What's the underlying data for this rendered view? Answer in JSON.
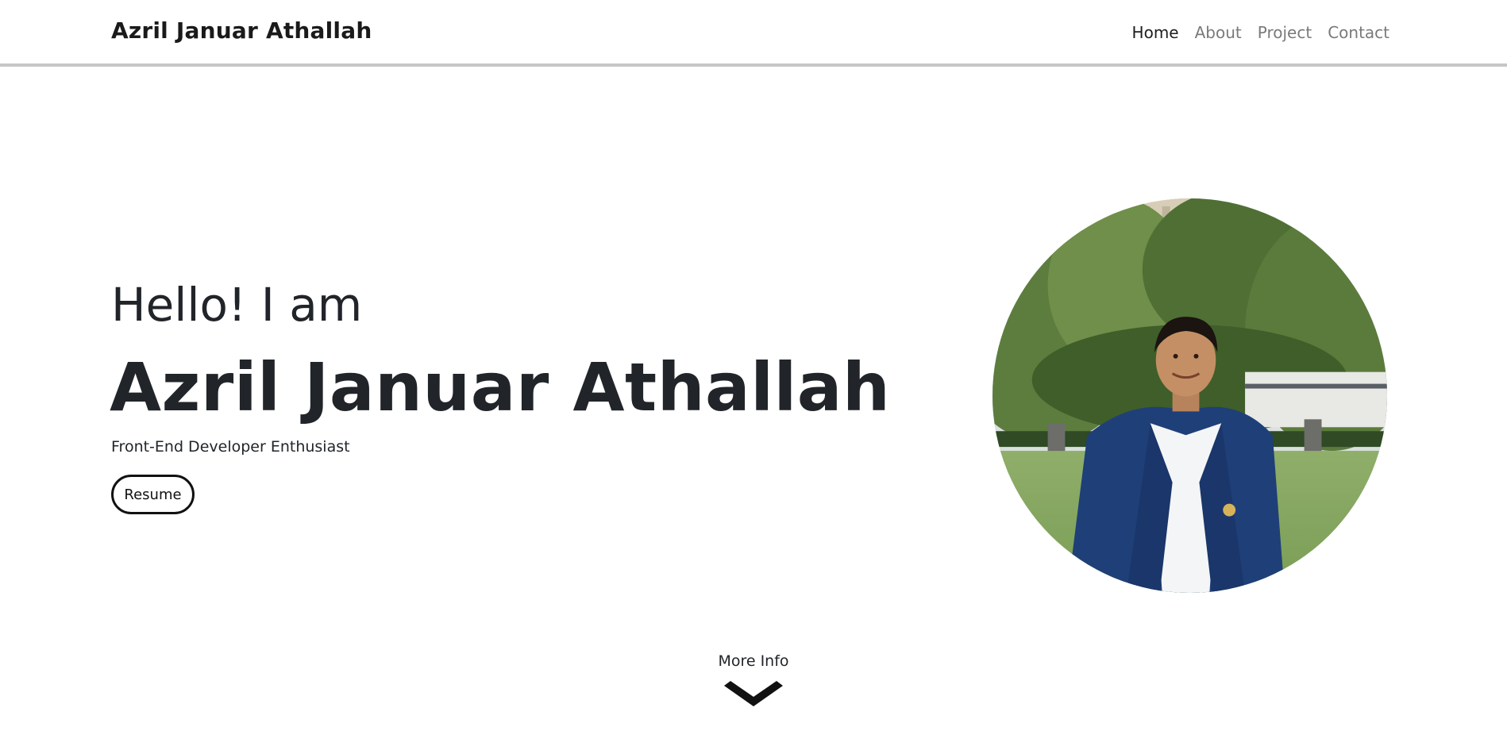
{
  "navbar": {
    "brand": "Azril Januar Athallah",
    "links": [
      {
        "label": "Home",
        "active": true
      },
      {
        "label": "About",
        "active": false
      },
      {
        "label": "Project",
        "active": false
      },
      {
        "label": "Contact",
        "active": false
      }
    ]
  },
  "hero": {
    "greeting": "Hello! I am",
    "name": "Azril Januar Athallah",
    "subtitle": "Front-End Developer Enthusiast",
    "resume_label": "Resume",
    "photo_icon": "profile-photo"
  },
  "footer_hint": {
    "label": "More Info",
    "icon": "chevron-down-icon"
  },
  "colors": {
    "text": "#212529",
    "nav_inactive": "#7a7a7a",
    "nav_border": "#c6c6c6"
  }
}
